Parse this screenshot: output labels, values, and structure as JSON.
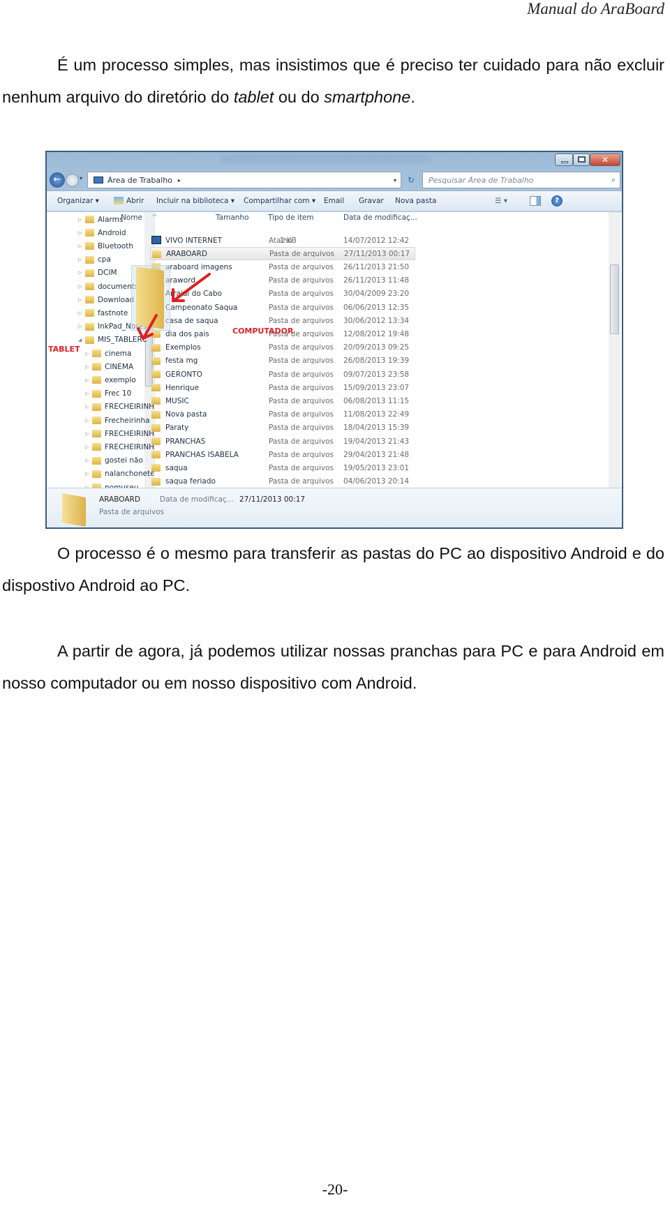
{
  "header": {
    "title": "Manual do AraBoard"
  },
  "paragraphs": [
    {
      "text_before": "É um processo simples, mas insistimos que é preciso ter cuidado para não excluir nenhum arquivo do diretório do ",
      "em1": "tablet",
      "middle": " ou do ",
      "em2": "smartphone",
      "end": "."
    },
    {
      "text": "O processo é o mesmo para transferir as pastas do PC ao dispositivo Android e do dispostivo Android ao PC."
    },
    {
      "text": "A partir de agora, já podemos utilizar nossas pranchas para PC e para Android em nosso computador ou em nosso dispositivo com Android."
    }
  ],
  "page_number": "-20-",
  "explorer": {
    "address": "Área de Trabalho",
    "search_placeholder": "Pesquisar Área de Trabalho",
    "toolbar": {
      "organize": "Organizar ▾",
      "open": "Abrir",
      "include": "Incluir na biblioteca ▾",
      "share": "Compartilhar com ▾",
      "email": "Email",
      "burn": "Gravar",
      "new_folder": "Nova pasta"
    },
    "columns": {
      "name": "Nome",
      "size": "Tamanho",
      "type": "Tipo de item",
      "date": "Data de modificaç..."
    },
    "nav_items": [
      {
        "label": "Alarms",
        "level": 0
      },
      {
        "label": "Android",
        "level": 0
      },
      {
        "label": "Bluetooth",
        "level": 0
      },
      {
        "label": "cpa",
        "level": 0
      },
      {
        "label": "DCIM",
        "level": 0
      },
      {
        "label": "documents",
        "level": 0
      },
      {
        "label": "Download",
        "level": 0
      },
      {
        "label": "fastnote",
        "level": 0
      },
      {
        "label": "InkPad_Notes",
        "level": 0
      },
      {
        "label": "MIS_TABLERO",
        "level": 0,
        "expanded": true
      },
      {
        "label": "cinema",
        "level": 1
      },
      {
        "label": "CINEMA",
        "level": 1
      },
      {
        "label": "exemplo",
        "level": 1
      },
      {
        "label": "Frec 10",
        "level": 1
      },
      {
        "label": "FRECHEIRINHA",
        "level": 1
      },
      {
        "label": "Frecheirinha",
        "level": 1
      },
      {
        "label": "FRECHEIRINHA",
        "level": 1
      },
      {
        "label": "FRECHEIRINHA",
        "level": 1
      },
      {
        "label": "gostei não",
        "level": 1
      },
      {
        "label": "nalanchonete",
        "level": 1
      },
      {
        "label": "nomuseu",
        "level": 1
      }
    ],
    "files": [
      {
        "name": "VIVO INTERNET",
        "size": "1 KB",
        "type": "Atalho",
        "date": "14/07/2012 12:42",
        "icon": "shortcut"
      },
      {
        "name": "ARABOARD",
        "size": "",
        "type": "Pasta de arquivos",
        "date": "27/11/2013 00:17",
        "selected": true
      },
      {
        "name": "araboard imagens",
        "size": "",
        "type": "Pasta de arquivos",
        "date": "26/11/2013 21:50"
      },
      {
        "name": "araword",
        "size": "",
        "type": "Pasta de arquivos",
        "date": "26/11/2013 11:48"
      },
      {
        "name": "Arraial do Cabo",
        "size": "",
        "type": "Pasta de arquivos",
        "date": "30/04/2009 23:20"
      },
      {
        "name": "Campeonato Saqua",
        "size": "",
        "type": "Pasta de arquivos",
        "date": "06/06/2013 12:35"
      },
      {
        "name": "casa de saqua",
        "size": "",
        "type": "Pasta de arquivos",
        "date": "30/06/2012 13:34"
      },
      {
        "name": "dia dos pais",
        "size": "",
        "type": "Pasta de arquivos",
        "date": "12/08/2012 19:48"
      },
      {
        "name": "Exemplos",
        "size": "",
        "type": "Pasta de arquivos",
        "date": "20/09/2013 09:25"
      },
      {
        "name": "festa mg",
        "size": "",
        "type": "Pasta de arquivos",
        "date": "26/08/2013 19:39"
      },
      {
        "name": "GERONTO",
        "size": "",
        "type": "Pasta de arquivos",
        "date": "09/07/2013 23:58"
      },
      {
        "name": "Henrique",
        "size": "",
        "type": "Pasta de arquivos",
        "date": "15/09/2013 23:07"
      },
      {
        "name": "MUSIC",
        "size": "",
        "type": "Pasta de arquivos",
        "date": "06/08/2013 11:15"
      },
      {
        "name": "Nova pasta",
        "size": "",
        "type": "Pasta de arquivos",
        "date": "11/08/2013 22:49"
      },
      {
        "name": "Paraty",
        "size": "",
        "type": "Pasta de arquivos",
        "date": "18/04/2013 15:39"
      },
      {
        "name": "PRANCHAS",
        "size": "",
        "type": "Pasta de arquivos",
        "date": "19/04/2013 21:43"
      },
      {
        "name": "PRANCHAS ISABELA",
        "size": "",
        "type": "Pasta de arquivos",
        "date": "29/04/2013 21:48"
      },
      {
        "name": "saqua",
        "size": "",
        "type": "Pasta de arquivos",
        "date": "19/05/2013 23:01"
      },
      {
        "name": "saqua feriado",
        "size": "",
        "type": "Pasta de arquivos",
        "date": "04/06/2013 20:14"
      }
    ],
    "details": {
      "name": "ARABOARD",
      "date_label": "Data de modificaç...",
      "date": "27/11/2013 00:17",
      "type": "Pasta de arquivos"
    },
    "annotations": {
      "computer": "COMPUTADOR",
      "tablet": "TABLET",
      "color": "#d8232a"
    }
  }
}
